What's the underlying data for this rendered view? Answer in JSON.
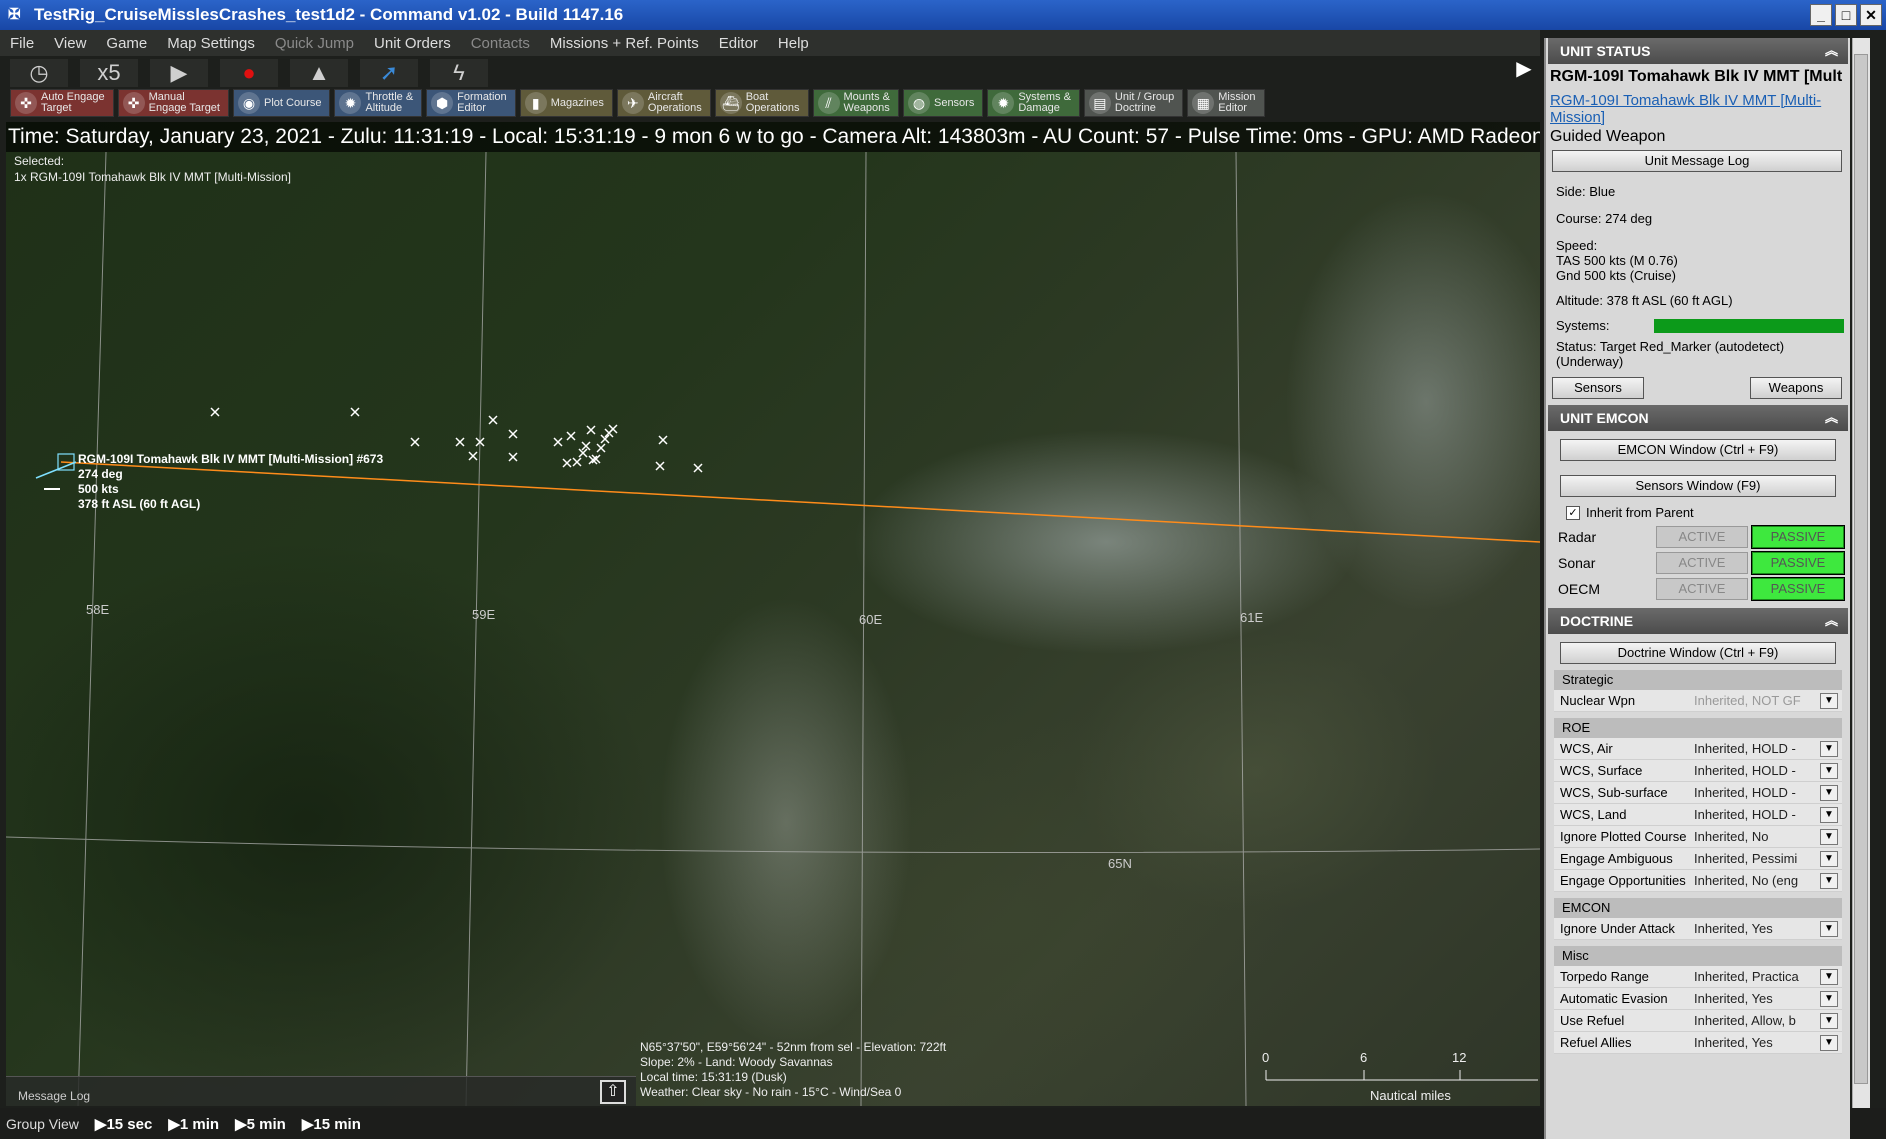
{
  "window": {
    "title": "TestRig_CruiseMisslesCrashes_test1d2 - Command v1.02 - Build 1147.16"
  },
  "menu": [
    {
      "label": "File",
      "enabled": true
    },
    {
      "label": "View",
      "enabled": true
    },
    {
      "label": "Game",
      "enabled": true
    },
    {
      "label": "Map Settings",
      "enabled": true
    },
    {
      "label": "Quick Jump",
      "enabled": false
    },
    {
      "label": "Unit Orders",
      "enabled": true
    },
    {
      "label": "Contacts",
      "enabled": false
    },
    {
      "label": "Missions + Ref. Points",
      "enabled": true
    },
    {
      "label": "Editor",
      "enabled": true
    },
    {
      "label": "Help",
      "enabled": true
    }
  ],
  "timebar": {
    "speed": "x5"
  },
  "toolbar": [
    {
      "line1": "Auto Engage",
      "line2": "Target",
      "icon": "crosshair-icon"
    },
    {
      "line1": "Manual",
      "line2": "Engage Target",
      "icon": "crosshair-icon"
    },
    {
      "line1": "Plot Course",
      "line2": "",
      "icon": "compass-icon"
    },
    {
      "line1": "Throttle &",
      "line2": "Altitude",
      "icon": "gear-icon"
    },
    {
      "line1": "Formation",
      "line2": "Editor",
      "icon": "formation-icon"
    },
    {
      "line1": "Magazines",
      "line2": "",
      "icon": "magazine-icon"
    },
    {
      "line1": "Aircraft",
      "line2": "Operations",
      "icon": "aircraft-icon"
    },
    {
      "line1": "Boat",
      "line2": "Operations",
      "icon": "boat-icon"
    },
    {
      "line1": "Mounts &",
      "line2": "Weapons",
      "icon": "weapons-icon"
    },
    {
      "line1": "Sensors",
      "line2": "",
      "icon": "sensor-icon"
    },
    {
      "line1": "Systems &",
      "line2": "Damage",
      "icon": "gear-icon"
    },
    {
      "line1": "Unit / Group",
      "line2": "Doctrine",
      "icon": "document-icon"
    },
    {
      "line1": "Mission",
      "line2": "Editor",
      "icon": "mission-icon"
    }
  ],
  "status_line": "Time: Saturday, January 23, 2021 - Zulu: 11:31:19 - Local: 15:31:19 - 9 mon 6 w to go -  Camera Alt: 143803m  - AU Count: 57 - Pulse Time: 0ms - GPU: AMD Radeon R",
  "selected": {
    "label": "Selected:",
    "item": "1x RGM-109I Tomahawk Blk IV MMT [Multi-Mission]"
  },
  "map": {
    "grid_labels": [
      "58E",
      "59E",
      "60E",
      "61E",
      "65N"
    ],
    "unit": {
      "name": "RGM-109I Tomahawk Blk IV MMT [Multi-Mission] #673",
      "course": "274 deg",
      "speed": "500 kts",
      "altitude": "378 ft ASL (60 ft AGL)"
    },
    "cursor_info": [
      "N65°37'50\", E59°56'24\" - 52nm from sel - Elevation: 722ft",
      "Slope: 2%  - Land: Woody Savannas",
      "Local time: 15:31:19 (Dusk)",
      "Weather: Clear sky - No rain - 15°C - Wind/Sea 0"
    ],
    "scale": {
      "ticks": [
        "0",
        "6",
        "12"
      ],
      "unit": "Nautical miles"
    },
    "message_log": "Message Log"
  },
  "bottombar": {
    "group_view": "Group View",
    "steps": [
      "15 sec",
      "1 min",
      "5 min",
      "15 min"
    ]
  },
  "panel": {
    "unit_status": {
      "header": "UNIT STATUS",
      "title": "RGM-109I Tomahawk Blk IV MMT [Mult",
      "link": "RGM-109I Tomahawk Blk IV MMT [Multi-Mission]",
      "type": "Guided Weapon",
      "message_log_btn": "Unit Message Log",
      "side": "Side: Blue",
      "course": "Course: 274 deg",
      "speed_label": "Speed:",
      "tas": "TAS 500 kts (M 0.76)",
      "gnd": "Gnd 500 kts (Cruise)",
      "altitude": "Altitude: 378 ft ASL (60 ft AGL)",
      "systems": "Systems:",
      "systems_health": 1.0,
      "status": "Status: Target Red_Marker (autodetect) (Underway)",
      "sensors_btn": "Sensors",
      "weapons_btn": "Weapons"
    },
    "emcon": {
      "header": "UNIT EMCON",
      "window_btn": "EMCON Window (Ctrl + F9)",
      "sensors_btn": "Sensors Window (F9)",
      "inherit": "Inherit from Parent",
      "rows": [
        {
          "label": "Radar",
          "active": "ACTIVE",
          "passive": "PASSIVE"
        },
        {
          "label": "Sonar",
          "active": "ACTIVE",
          "passive": "PASSIVE"
        },
        {
          "label": "OECM",
          "active": "ACTIVE",
          "passive": "PASSIVE"
        }
      ]
    },
    "doctrine": {
      "header": "DOCTRINE",
      "window_btn": "Doctrine Window (Ctrl + F9)",
      "groups": [
        {
          "title": "Strategic",
          "rows": [
            {
              "k": "Nuclear Wpn",
              "v": "Inherited, NOT GF",
              "dim": true
            }
          ]
        },
        {
          "title": "ROE",
          "rows": [
            {
              "k": "WCS, Air",
              "v": "Inherited, HOLD -"
            },
            {
              "k": "WCS, Surface",
              "v": "Inherited, HOLD -"
            },
            {
              "k": "WCS, Sub-surface",
              "v": "Inherited, HOLD -"
            },
            {
              "k": "WCS, Land",
              "v": "Inherited, HOLD -"
            },
            {
              "k": "Ignore Plotted Course",
              "v": "Inherited, No"
            },
            {
              "k": "Engage Ambiguous",
              "v": "Inherited, Pessimi"
            },
            {
              "k": "Engage Opportunities",
              "v": "Inherited, No (eng"
            }
          ]
        },
        {
          "title": "EMCON",
          "rows": [
            {
              "k": "Ignore Under Attack",
              "v": "Inherited, Yes"
            }
          ]
        },
        {
          "title": "Misc",
          "rows": [
            {
              "k": "Torpedo Range",
              "v": "Inherited, Practica"
            },
            {
              "k": "Automatic Evasion",
              "v": "Inherited, Yes"
            },
            {
              "k": "Use Refuel",
              "v": "Inherited, Allow, b"
            },
            {
              "k": "Refuel Allies",
              "v": "Inherited, Yes"
            }
          ]
        }
      ]
    }
  }
}
